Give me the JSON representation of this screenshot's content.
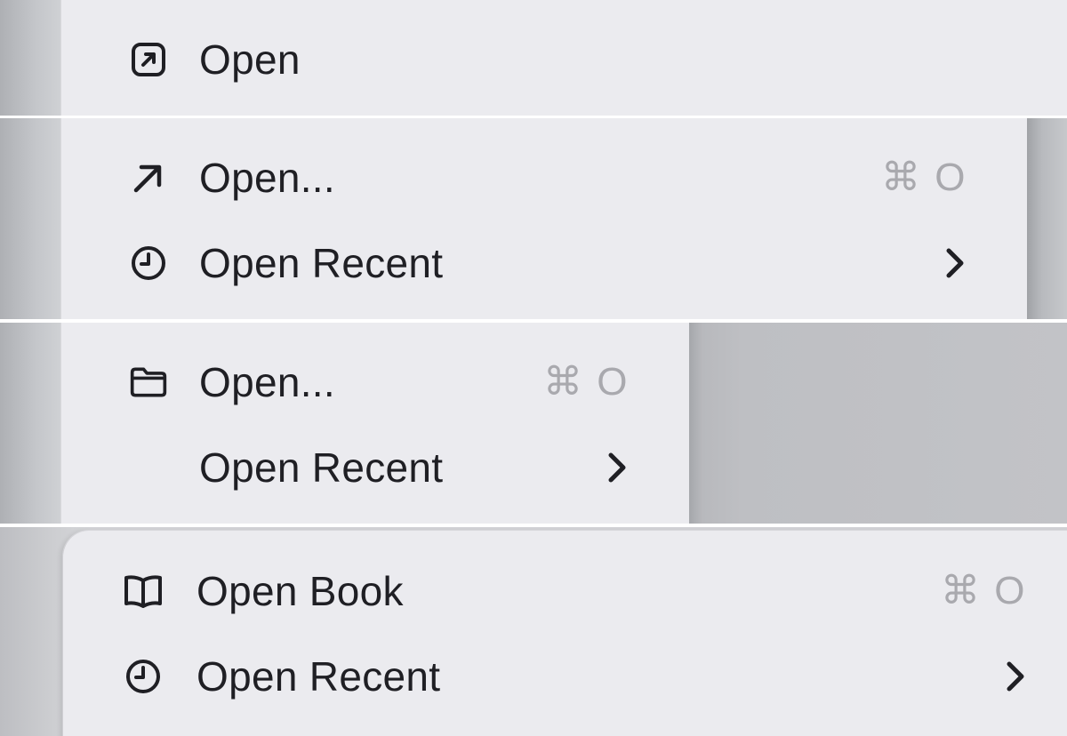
{
  "variants": [
    {
      "items": [
        {
          "label": "Open",
          "icon": "arrow-up-right-square-icon"
        }
      ]
    },
    {
      "items": [
        {
          "label": "Open...",
          "icon": "arrow-up-right-icon",
          "shortcut": "⌘ O"
        },
        {
          "label": "Open Recent",
          "icon": "clock-icon",
          "submenu": true
        }
      ]
    },
    {
      "items": [
        {
          "label": "Open...",
          "icon": "folder-icon",
          "shortcut": "⌘ O"
        },
        {
          "label": "Open Recent",
          "submenu": true
        }
      ]
    },
    {
      "items": [
        {
          "label": "Open Book",
          "icon": "book-icon",
          "shortcut": "⌘ O"
        },
        {
          "label": "Open Recent",
          "icon": "clock-icon",
          "submenu": true
        }
      ]
    }
  ],
  "colors": {
    "menu_background": "#ebebef",
    "text": "#1f1f24",
    "shortcut_text": "#a9a9ae",
    "backdrop": "#c6c8cb"
  }
}
